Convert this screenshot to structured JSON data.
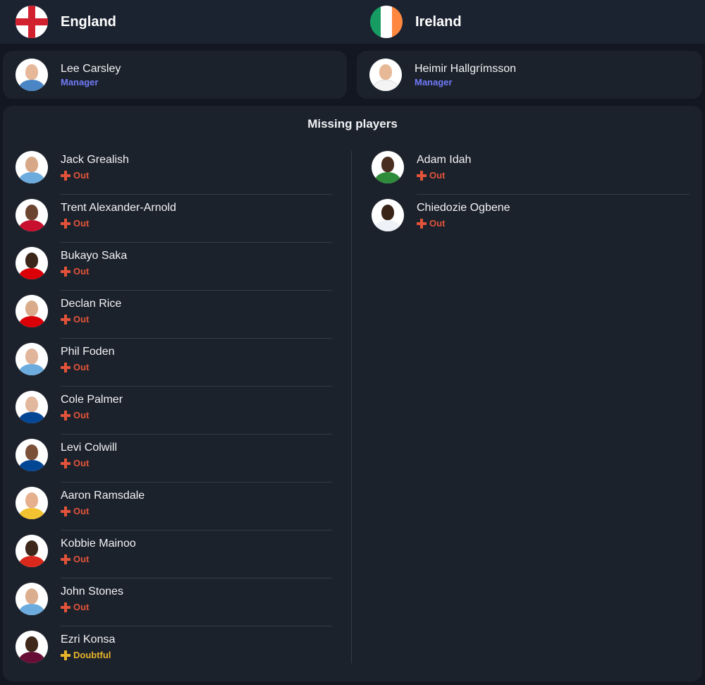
{
  "teams": {
    "home": {
      "name": "England",
      "flag_icon": "england-flag-icon",
      "manager": {
        "name": "Lee Carsley",
        "role": "Manager"
      }
    },
    "away": {
      "name": "Ireland",
      "flag_icon": "ireland-flag-icon",
      "flag_colors": [
        "#169b62",
        "#ffffff",
        "#ff883e"
      ],
      "manager": {
        "name": "Heimir Hallgrímsson",
        "role": "Manager"
      }
    }
  },
  "missing": {
    "title": "Missing players",
    "home": [
      {
        "name": "Jack Grealish",
        "status": "Out",
        "shirt": "#6cabdd",
        "skin": "#d7a888"
      },
      {
        "name": "Trent Alexander-Arnold",
        "status": "Out",
        "shirt": "#c8102e",
        "skin": "#6b4431"
      },
      {
        "name": "Bukayo Saka",
        "status": "Out",
        "shirt": "#db0007",
        "skin": "#3b2418"
      },
      {
        "name": "Declan Rice",
        "status": "Out",
        "shirt": "#db0007",
        "skin": "#d9ab8b"
      },
      {
        "name": "Phil Foden",
        "status": "Out",
        "shirt": "#6cabdd",
        "skin": "#e0b59a"
      },
      {
        "name": "Cole Palmer",
        "status": "Out",
        "shirt": "#034694",
        "skin": "#e2b89c"
      },
      {
        "name": "Levi Colwill",
        "status": "Out",
        "shirt": "#034694",
        "skin": "#7a5038"
      },
      {
        "name": "Aaron Ramsdale",
        "status": "Out",
        "shirt": "#f2c230",
        "skin": "#e6b08e"
      },
      {
        "name": "Kobbie Mainoo",
        "status": "Out",
        "shirt": "#da291c",
        "skin": "#3d261a"
      },
      {
        "name": "John Stones",
        "status": "Out",
        "shirt": "#6cabdd",
        "skin": "#dcae90"
      },
      {
        "name": "Ezri Konsa",
        "status": "Doubtful",
        "shirt": "#670e36",
        "skin": "#3f271a"
      }
    ],
    "away": [
      {
        "name": "Adam Idah",
        "status": "Out",
        "shirt": "#2e8b3a",
        "skin": "#4a2e20"
      },
      {
        "name": "Chiedozie Ogbene",
        "status": "Out",
        "shirt": "#eef2f6",
        "skin": "#3a2417"
      }
    ]
  },
  "manager_avatars": {
    "home": {
      "shirt": "#4a86c5",
      "skin": "#e7b79a"
    },
    "away": {
      "shirt": "#f4f4f4",
      "skin": "#e6b896"
    }
  }
}
